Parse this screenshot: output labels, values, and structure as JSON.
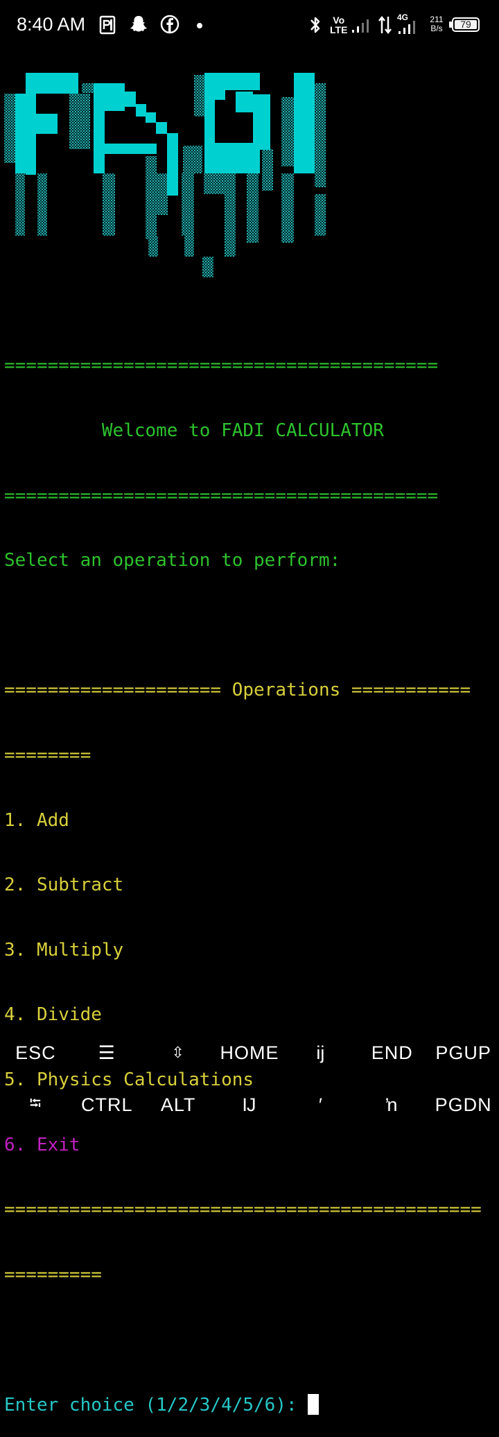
{
  "status_bar": {
    "time": "8:40 AM",
    "volte": "Vo\nLTE",
    "net_type": "4G",
    "speed_value": "211",
    "speed_unit": "B/s",
    "battery": "79"
  },
  "banner": {
    "ascii_logo_text": "FADI",
    "colors": {
      "bright": "#00d0d0",
      "dim": "#23a7a7"
    }
  },
  "terminal": {
    "separator_long": "========================================",
    "welcome": "Welcome to FADI CALCULATOR",
    "prompt_select": "Select an operation to perform:",
    "operations_header": "==================== Operations ===========",
    "operations_header_wrap": "========",
    "options": [
      "1. Add",
      "2. Subtract",
      "3. Multiply",
      "4. Divide",
      "5. Physics Calculations",
      "6. Exit"
    ],
    "footer_separator": "============================================",
    "footer_separator_wrap": "=========",
    "input_prompt": "Enter choice (1/2/3/4/5/6): "
  },
  "extra_keys": {
    "row1": [
      "ESC",
      "☰",
      "⇳",
      "HOME",
      "ĳ",
      "END",
      "PGUP"
    ],
    "row2": [
      "⭾",
      "CTRL",
      "ALT",
      "Ĳ",
      "′",
      "ŉ",
      "PGDN"
    ]
  }
}
